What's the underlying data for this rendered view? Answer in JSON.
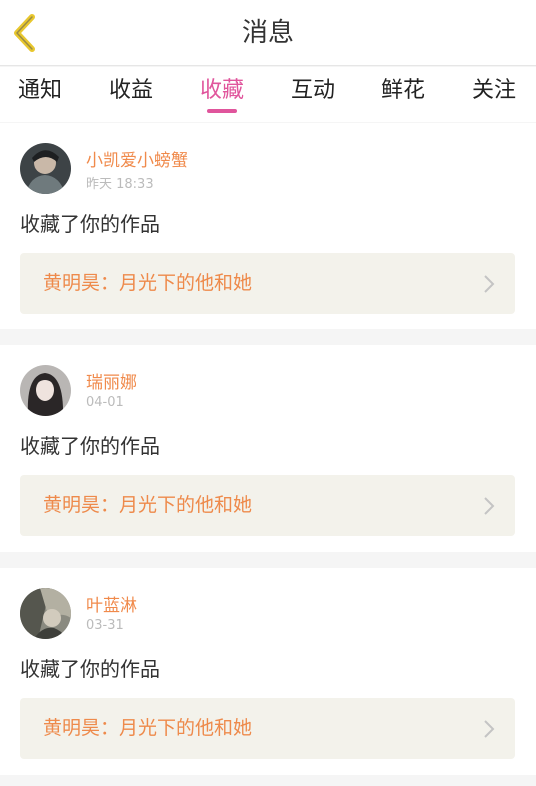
{
  "header": {
    "title": "消息"
  },
  "tabs": [
    {
      "label": "通知"
    },
    {
      "label": "收益"
    },
    {
      "label": "收藏",
      "active": true
    },
    {
      "label": "互动"
    },
    {
      "label": "鲜花"
    },
    {
      "label": "关注"
    }
  ],
  "messages": [
    {
      "username": "小凯爱小螃蟹",
      "time": "昨天 18:33",
      "action": "收藏了你的作品",
      "work": "黄明昊：月光下的他和她"
    },
    {
      "username": "瑞丽娜",
      "time": "04-01",
      "action": "收藏了你的作品",
      "work": "黄明昊：月光下的他和她"
    },
    {
      "username": "叶蓝淋",
      "time": "03-31",
      "action": "收藏了你的作品",
      "work": "黄明昊：月光下的他和她"
    }
  ],
  "colors": {
    "accent_pink": "#e0559c",
    "username_orange": "#f08a4b",
    "back_arrow_yellow": "#e8c72e",
    "link_bg": "#f3f2eb"
  },
  "icons": {
    "back": "back-arrow-icon",
    "chevron": "chevron-right-icon"
  }
}
